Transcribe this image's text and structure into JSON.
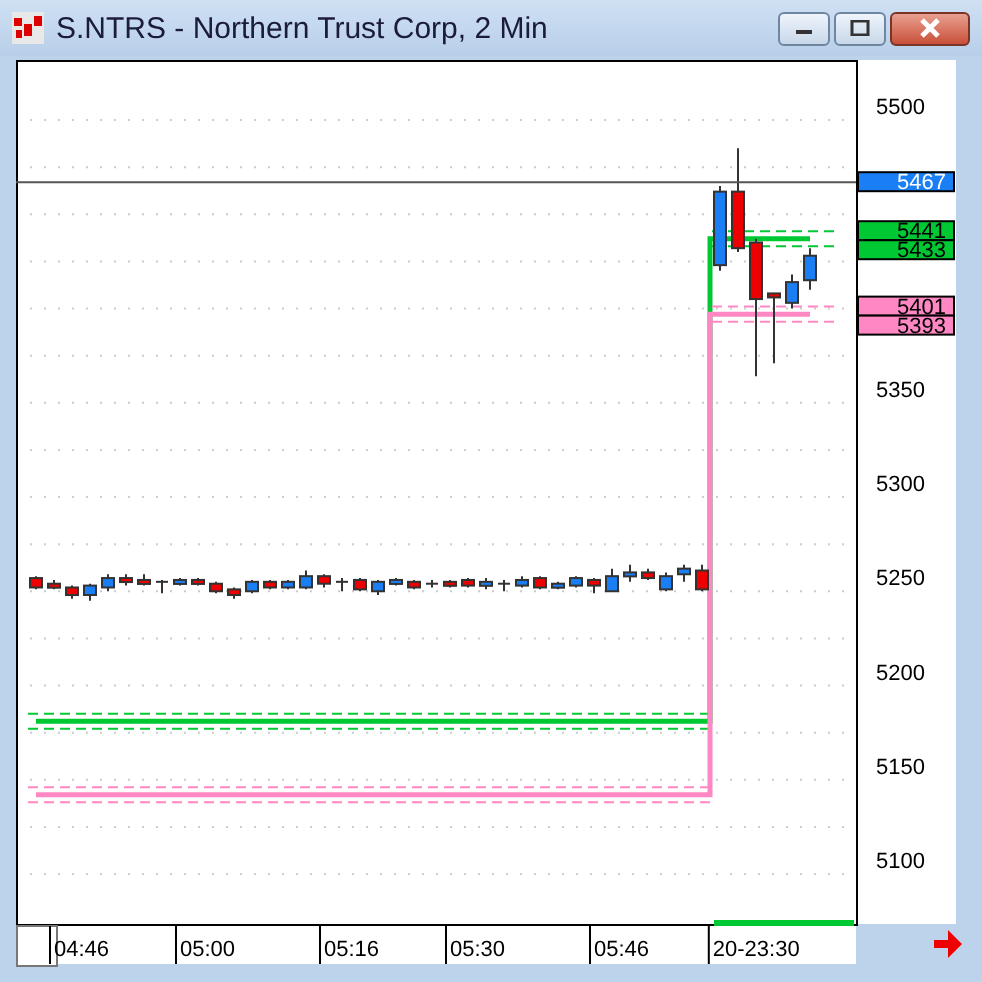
{
  "window": {
    "title": "S.NTRS - Northern Trust Corp, 2 Min"
  },
  "price_axis": {
    "labels": [
      "5500",
      "5350",
      "5300",
      "5250",
      "5200",
      "5150",
      "5100"
    ]
  },
  "price_tags": [
    {
      "label": "5467",
      "color": "#1a7ef5"
    },
    {
      "label": "5441",
      "color": "#00c832"
    },
    {
      "label": "5433",
      "color": "#00c832"
    },
    {
      "label": "5401",
      "color": "#ff88c4"
    },
    {
      "label": "5393",
      "color": "#ff88c4"
    }
  ],
  "time_axis": {
    "labels": [
      "04:46",
      "05:00",
      "05:16",
      "05:30",
      "05:46",
      "20-23:30"
    ]
  }
}
